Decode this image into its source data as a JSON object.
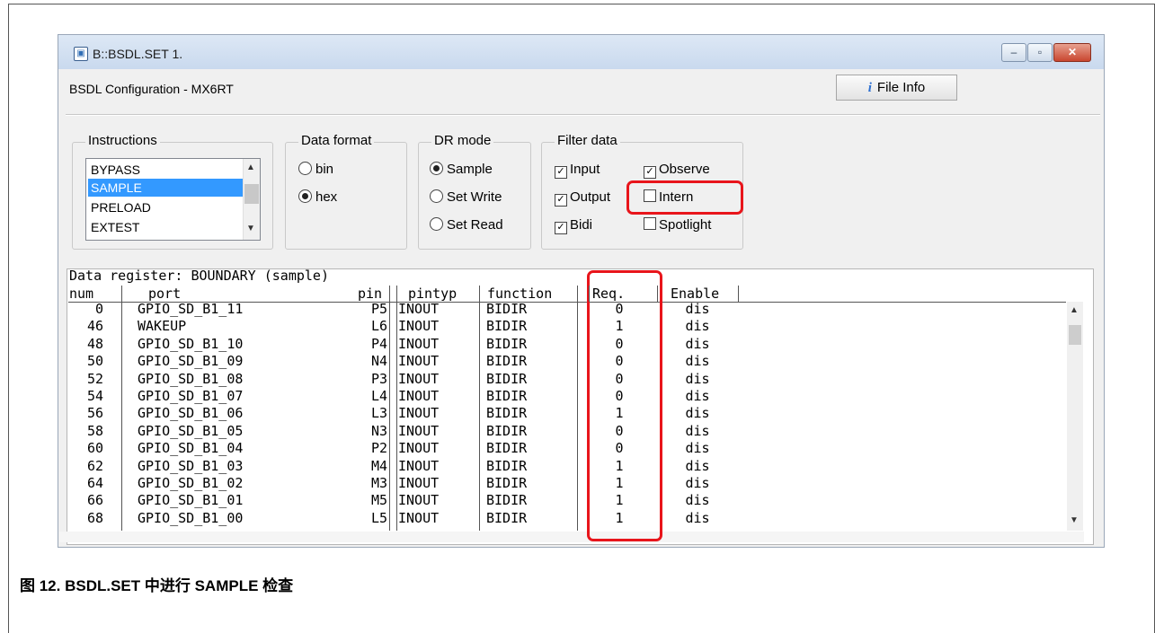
{
  "window": {
    "title": "B::BSDL.SET 1.",
    "controls": {
      "minimize": "–",
      "maximize": "▫",
      "close": "✕"
    }
  },
  "header": {
    "config_label": "BSDL Configuration -  MX6RT",
    "file_info_button": "File Info",
    "file_info_icon": "info-icon"
  },
  "instructions": {
    "label": "Instructions",
    "items": [
      "BYPASS",
      "SAMPLE",
      "PRELOAD",
      "EXTEST"
    ],
    "selected": "SAMPLE"
  },
  "data_format": {
    "label": "Data format",
    "options": [
      "bin",
      "hex"
    ],
    "selected": "hex"
  },
  "dr_mode": {
    "label": "DR mode",
    "options": [
      "Sample",
      "Set Write",
      "Set Read"
    ],
    "selected": "Sample"
  },
  "filter_data": {
    "label": "Filter data",
    "input": {
      "label": "Input",
      "checked": true
    },
    "observe": {
      "label": "Observe",
      "checked": true
    },
    "output": {
      "label": "Output",
      "checked": true
    },
    "intern": {
      "label": "Intern",
      "checked": false
    },
    "bidi": {
      "label": "Bidi",
      "checked": true
    },
    "spotlight": {
      "label": "Spotlight",
      "checked": false
    }
  },
  "data_register": {
    "label": "Data register: BOUNDARY (sample)",
    "columns": [
      "num",
      "port",
      "pin",
      "pintyp",
      "function",
      "Req.",
      "Enable"
    ],
    "rows": [
      [
        "0",
        "GPIO_SD_B1_11",
        "P5",
        "INOUT",
        "BIDIR",
        "0",
        "dis"
      ],
      [
        "46",
        "WAKEUP",
        "L6",
        "INOUT",
        "BIDIR",
        "1",
        "dis"
      ],
      [
        "48",
        "GPIO_SD_B1_10",
        "P4",
        "INOUT",
        "BIDIR",
        "0",
        "dis"
      ],
      [
        "50",
        "GPIO_SD_B1_09",
        "N4",
        "INOUT",
        "BIDIR",
        "0",
        "dis"
      ],
      [
        "52",
        "GPIO_SD_B1_08",
        "P3",
        "INOUT",
        "BIDIR",
        "0",
        "dis"
      ],
      [
        "54",
        "GPIO_SD_B1_07",
        "L4",
        "INOUT",
        "BIDIR",
        "0",
        "dis"
      ],
      [
        "56",
        "GPIO_SD_B1_06",
        "L3",
        "INOUT",
        "BIDIR",
        "1",
        "dis"
      ],
      [
        "58",
        "GPIO_SD_B1_05",
        "N3",
        "INOUT",
        "BIDIR",
        "0",
        "dis"
      ],
      [
        "60",
        "GPIO_SD_B1_04",
        "P2",
        "INOUT",
        "BIDIR",
        "0",
        "dis"
      ],
      [
        "62",
        "GPIO_SD_B1_03",
        "M4",
        "INOUT",
        "BIDIR",
        "1",
        "dis"
      ],
      [
        "64",
        "GPIO_SD_B1_02",
        "M3",
        "INOUT",
        "BIDIR",
        "1",
        "dis"
      ],
      [
        "66",
        "GPIO_SD_B1_01",
        "M5",
        "INOUT",
        "BIDIR",
        "1",
        "dis"
      ],
      [
        "68",
        "GPIO_SD_B1_00",
        "L5",
        "INOUT",
        "BIDIR",
        "1",
        "dis"
      ]
    ]
  },
  "highlight_color": "#e8151b",
  "selection_color": "#3399ff",
  "caption": "图 12. BSDL.SET 中进行 SAMPLE 检查"
}
